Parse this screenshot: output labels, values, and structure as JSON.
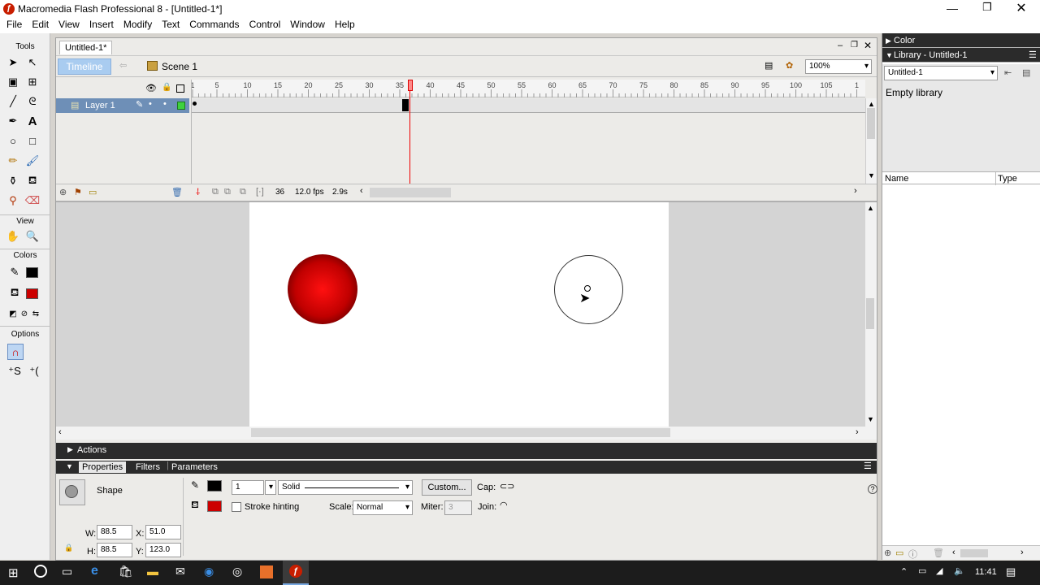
{
  "window": {
    "title": "Macromedia Flash Professional 8 - [Untitled-1*]"
  },
  "menu": [
    "File",
    "Edit",
    "View",
    "Insert",
    "Modify",
    "Text",
    "Commands",
    "Control",
    "Window",
    "Help"
  ],
  "tools": {
    "title": "Tools",
    "view": "View",
    "colors": "Colors",
    "options": "Options"
  },
  "document": {
    "tab": "Untitled-1*",
    "timeline_btn": "Timeline",
    "scene": "Scene 1",
    "zoom": "100%"
  },
  "timeline": {
    "layer": "Layer 1",
    "frame": "36",
    "fps": "12.0 fps",
    "time": "2.9s",
    "ruler": [
      "1",
      "5",
      "10",
      "15",
      "20",
      "25",
      "30",
      "35",
      "40",
      "45",
      "50",
      "55",
      "60",
      "65",
      "70",
      "75",
      "80",
      "85",
      "90",
      "95",
      "100",
      "105",
      "1"
    ]
  },
  "panels": {
    "actions": "Actions",
    "tabs": [
      "Properties",
      "Filters",
      "Parameters"
    ]
  },
  "properties": {
    "type": "Shape",
    "stroke_width": "1",
    "stroke_style": "Solid",
    "custom_btn": "Custom...",
    "cap": "Cap:",
    "stroke_hinting": "Stroke hinting",
    "scale_label": "Scale:",
    "scale": "Normal",
    "miter_label": "Miter:",
    "miter": "3",
    "join": "Join:",
    "w_label": "W:",
    "w": "88.5",
    "h_label": "H:",
    "h": "88.5",
    "x_label": "X:",
    "x": "51.0",
    "y_label": "Y:",
    "y": "123.0"
  },
  "right": {
    "color": "Color",
    "library_title": "Library - Untitled-1",
    "library_select": "Untitled-1",
    "empty": "Empty library",
    "col_name": "Name",
    "col_type": "Type"
  },
  "taskbar": {
    "clock": "11:41"
  },
  "colors": {
    "stroke": "#000000",
    "fill": "#cc0000",
    "accent": "#1a73c8"
  }
}
